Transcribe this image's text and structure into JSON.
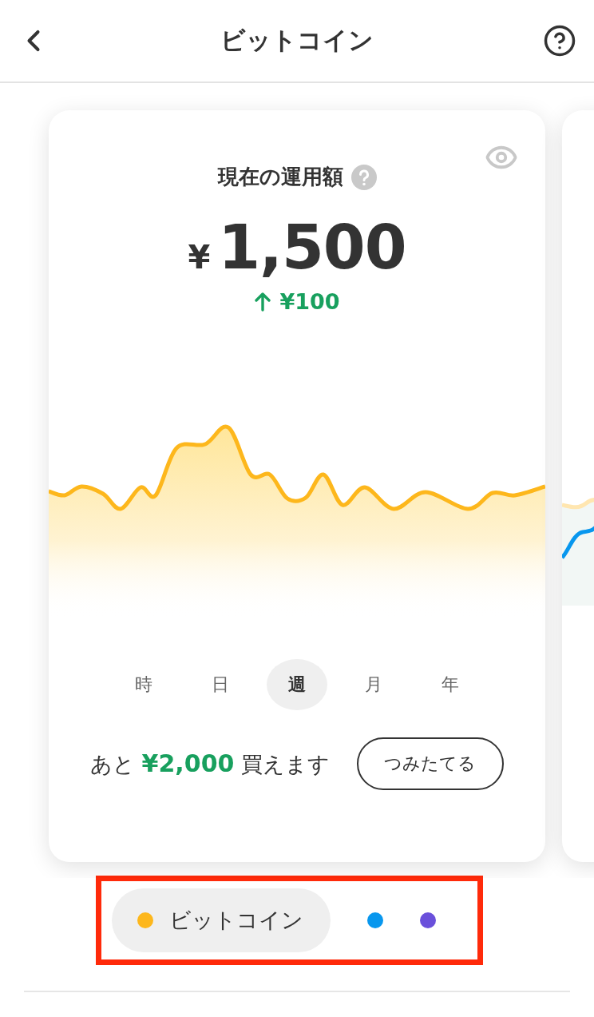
{
  "header": {
    "title": "ビットコイン"
  },
  "card": {
    "title": "現在の運用額",
    "currency": "¥",
    "amount": "1,500",
    "change": "¥100",
    "periods": [
      {
        "label": "時",
        "selected": false
      },
      {
        "label": "日",
        "selected": false
      },
      {
        "label": "週",
        "selected": true
      },
      {
        "label": "月",
        "selected": false
      },
      {
        "label": "年",
        "selected": false
      }
    ],
    "remaining": "あと **¥2,000** 買えます",
    "button": "つみたてる"
  },
  "indicators": [
    {
      "label": "ビットコイン",
      "color": "#fdb71c",
      "selected": true
    },
    {
      "color": "#0897ee",
      "selected": false
    },
    {
      "color": "#6a50db",
      "selected": false
    }
  ]
}
